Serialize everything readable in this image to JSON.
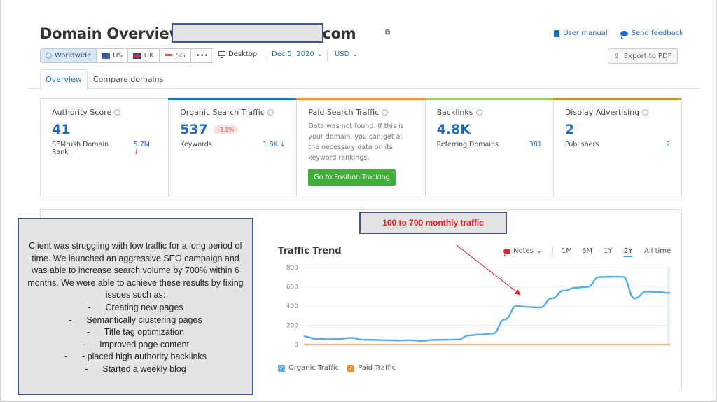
{
  "header": {
    "title_prefix": "Domain Overview:",
    "domain_visible_tail": "ates.com",
    "user_manual": "User manual",
    "send_feedback": "Send feedback",
    "export_pdf": "Export to PDF"
  },
  "databases": [
    {
      "label": "Worldwide",
      "icon": "globe-icon",
      "active": true
    },
    {
      "label": "US",
      "icon": "us-flag-icon",
      "active": false
    },
    {
      "label": "UK",
      "icon": "uk-flag-icon",
      "active": false
    },
    {
      "label": "SG",
      "icon": "sg-flag-icon",
      "active": false
    },
    {
      "label": "•••",
      "icon": "more-icon",
      "active": false
    }
  ],
  "options": {
    "device": "Desktop",
    "date": "Dec 5, 2020",
    "currency": "USD"
  },
  "tabs": [
    {
      "label": "Overview",
      "active": true
    },
    {
      "label": "Compare domains",
      "active": false
    }
  ],
  "cards": {
    "authority": {
      "title": "Authority Score",
      "value": "41",
      "sub_label": "SEMrush Domain Rank",
      "sub_value": "5.7M",
      "trend": "down",
      "accent": ""
    },
    "organic": {
      "title": "Organic Search Traffic",
      "value": "537",
      "badge": "-3.1%",
      "sub_label": "Keywords",
      "sub_value": "1.8K",
      "trend": "down",
      "accent": "#1e6cc4"
    },
    "paid": {
      "title": "Paid Search Traffic",
      "message": "Data was not found. If this is your domain, you can get all the necessary data on its keyword rankings.",
      "button": "Go to Position Tracking",
      "accent": "#f08c3a"
    },
    "backlinks": {
      "title": "Backlinks",
      "value": "4.8K",
      "sub_label": "Referring Domains",
      "sub_value": "381",
      "accent": "#8fcf5f"
    },
    "display": {
      "title": "Display Advertising",
      "value": "2",
      "sub_label": "Publishers",
      "sub_value": "2",
      "accent": "#c98a3a"
    }
  },
  "annotation": {
    "intro": "Client was struggling with low traffic for a long period of time. We launched an aggressive SEO campaign and was able to increase search volume by 700% within 6 months. We were able to achieve these results by fixing issues such as:",
    "items": [
      "-      Creating new pages",
      "-      Semantically clustering pages",
      "-      Title tag optimization",
      "-      Improved page content",
      "-      - placed high authority backlinks",
      "-      Started a weekly blog"
    ],
    "callout": "100 to 700 monthly traffic"
  },
  "trend": {
    "title": "Traffic Trend",
    "notes": "Notes",
    "ranges": [
      "1M",
      "6M",
      "1Y",
      "2Y",
      "All time"
    ],
    "active_range": "2Y"
  },
  "chart_data": {
    "type": "line",
    "title": "Traffic Trend",
    "xlabel": "",
    "ylabel": "",
    "ylim": [
      0,
      800
    ],
    "yticks": [
      0,
      200,
      400,
      600,
      800
    ],
    "grid": true,
    "legend": "bottom-left",
    "series": [
      {
        "name": "Organic Traffic",
        "color": "#5aaee8",
        "values": [
          85,
          60,
          55,
          58,
          70,
          50,
          48,
          45,
          42,
          45,
          38,
          48,
          50,
          52,
          95,
          105,
          115,
          260,
          400,
          390,
          385,
          480,
          560,
          590,
          600,
          700,
          705,
          705,
          480,
          550,
          545,
          535
        ]
      },
      {
        "name": "Paid Traffic",
        "color": "#f0b888",
        "values": [
          0,
          0,
          0,
          0,
          0,
          0,
          0,
          0,
          0,
          0,
          0,
          0,
          0,
          0,
          0,
          0,
          0,
          0,
          0,
          0,
          0,
          0,
          0,
          0,
          0,
          0,
          0,
          0,
          0,
          0,
          0,
          0
        ]
      }
    ]
  }
}
